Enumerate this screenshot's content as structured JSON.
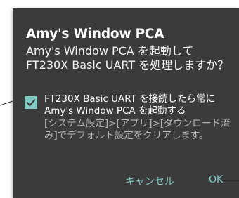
{
  "dialog": {
    "title": "Amy's Window PCA",
    "message": "Amy's Window PCA を起動して FT230X Basic UART を処理しますか？",
    "checkbox": {
      "checked": true,
      "label": "FT230X Basic UART を接続したら常に Amy's Window PCA を起動する"
    },
    "hint": "[システム設定]>[アプリ]>[ダウンロード済み]でデフォルト設定をクリアします。",
    "buttons": {
      "cancel": "キャンセル",
      "ok": "OK"
    }
  },
  "colors": {
    "dialog_background": "#3b3b3b",
    "accent": "#80cbc4",
    "text": "#ffffff",
    "hint_text": "#b5b5b5"
  },
  "icons": {
    "checkbox": "check-icon"
  }
}
